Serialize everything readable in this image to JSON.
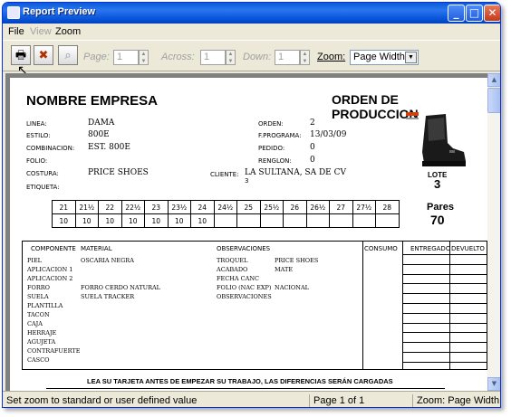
{
  "window": {
    "title": "Report Preview"
  },
  "menu": [
    "File",
    "View",
    "Zoom"
  ],
  "toolbar": {
    "page_label": "Page:",
    "page_value": "1",
    "across_label": "Across:",
    "across_value": "1",
    "down_label": "Down:",
    "down_value": "1",
    "zoom_label": "Zoom:",
    "zoom_value": "Page Width"
  },
  "report": {
    "company": "NOMBRE EMPRESA",
    "doc_title": "ORDEN DE PRODUCCION",
    "fields_left": [
      {
        "label": "LINEA:",
        "value": "DAMA"
      },
      {
        "label": "ESTILO:",
        "value": "800E"
      },
      {
        "label": "COMBINACION:",
        "value": "EST. 800E"
      },
      {
        "label": "FOLIO:",
        "value": ""
      },
      {
        "label": "COSTURA:",
        "value": "PRICE SHOES"
      },
      {
        "label": "ETIQUETA:",
        "value": ""
      }
    ],
    "fields_right": [
      {
        "label": "ORDEN:",
        "value": "2"
      },
      {
        "label": "F.PROGRAMA:",
        "value": "13/03/09"
      },
      {
        "label": "PEDIDO:",
        "value": "0"
      },
      {
        "label": "RENGLON:",
        "value": "0"
      }
    ],
    "cliente_label": "CLIENTE:",
    "cliente_value": "LA SULTANA, SA DE CV",
    "cliente_num": "3",
    "lote_label": "LOTE",
    "lote_value": "3",
    "pares_label": "Pares",
    "pares_value": "70",
    "sizes": [
      "21",
      "21½",
      "22",
      "22½",
      "23",
      "23½",
      "24",
      "24½",
      "25",
      "25½",
      "26",
      "26½",
      "27",
      "27½",
      "28"
    ],
    "quantities": [
      "10",
      "10",
      "10",
      "10",
      "10",
      "10",
      "10",
      "",
      "",
      "",
      "",
      "",
      "",
      "",
      ""
    ],
    "headers": {
      "componente": "COMPONENTE",
      "material": "MATERIAL",
      "observaciones": "OBSERVACIONES",
      "consumo": "CONSUMO",
      "entrega": "ENTREGADO",
      "devuelto": "DEVUELTO"
    },
    "componentes": [
      "PIEL",
      "APLICACION 1",
      "APLICACION 2",
      "FORRO",
      "SUELA",
      "PLANTILLA",
      "TACON",
      "CAJA",
      "HERRAJE",
      "AGUJETA",
      "CONTRAFUERTE",
      "CASCO"
    ],
    "materiales": [
      "OSCARIA NEGRA",
      "",
      "",
      "FORRO CERDO NATURAL",
      "SUELA TRACKER"
    ],
    "obs_labels": [
      "TROQUEL",
      "ACABADO",
      "FECHA CANC",
      "FOLIO (NAC EXP)",
      "OBSERVACIONES"
    ],
    "obs_values": [
      "PRICE SHOES",
      "MATE",
      "",
      "NACIONAL",
      ""
    ],
    "footer": "LEA SU TARJETA ANTES DE EMPEZAR SU TRABAJO, LAS DIFERENCIAS SERÁN CARGADAS"
  },
  "status": {
    "hint": "Set zoom to standard or user defined value",
    "page": "Page 1 of 1",
    "zoom": "Zoom: Page Width"
  }
}
